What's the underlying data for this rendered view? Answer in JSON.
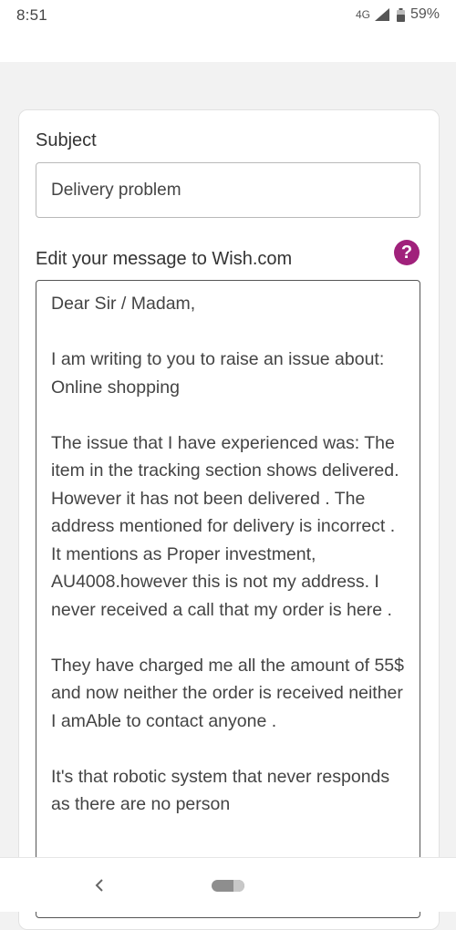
{
  "status_bar": {
    "time": "8:51",
    "network": "4G",
    "battery": "59%"
  },
  "form": {
    "subject_label": "Subject",
    "subject_value": "Delivery problem",
    "message_label": "Edit your message to Wish.com",
    "help_icon_glyph": "?",
    "message_text": "Dear Sir / Madam,\n\nI am writing to you to raise an issue about: Online shopping\n\nThe issue that I have experienced was: The item in the tracking section shows delivered. However it has not been delivered . The address mentioned for delivery is incorrect . It mentions as Proper investment, AU4008.however this is not my address. I never received a call that my order is here .\n\nThey have charged me all the amount of 55$ and now neither the order is received neither I amAble to contact anyone .\n\nIt's that robotic system that never responds as there are no person"
  },
  "colors": {
    "accent": "#a0217b",
    "background": "#f2f2f2"
  },
  "icons": {
    "help": "question-circle-icon",
    "back": "chevron-left-icon",
    "home": "home-pill-icon",
    "signal": "signal-icon",
    "battery": "battery-icon"
  }
}
